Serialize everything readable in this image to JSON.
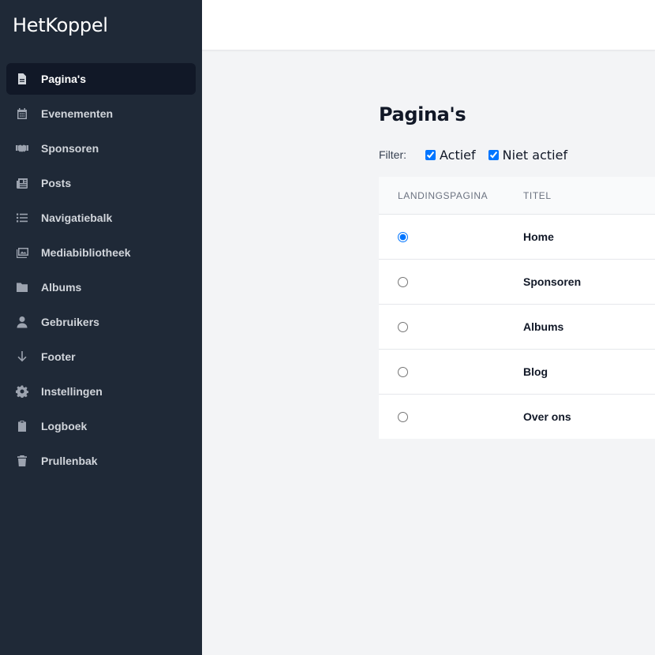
{
  "app": {
    "brand": "HetKoppel"
  },
  "sidebar": {
    "items": [
      {
        "label": "Pagina's",
        "icon": "file-icon",
        "active": true
      },
      {
        "label": "Evenementen",
        "icon": "calendar-icon",
        "active": false
      },
      {
        "label": "Sponsoren",
        "icon": "handshake-icon",
        "active": false
      },
      {
        "label": "Posts",
        "icon": "newspaper-icon",
        "active": false
      },
      {
        "label": "Navigatiebalk",
        "icon": "list-icon",
        "active": false
      },
      {
        "label": "Mediabibliotheek",
        "icon": "images-icon",
        "active": false
      },
      {
        "label": "Albums",
        "icon": "folder-icon",
        "active": false
      },
      {
        "label": "Gebruikers",
        "icon": "user-icon",
        "active": false
      },
      {
        "label": "Footer",
        "icon": "arrow-down-icon",
        "active": false
      },
      {
        "label": "Instellingen",
        "icon": "gear-icon",
        "active": false
      },
      {
        "label": "Logboek",
        "icon": "clipboard-icon",
        "active": false
      },
      {
        "label": "Prullenbak",
        "icon": "trash-icon",
        "active": false
      }
    ]
  },
  "main": {
    "title": "Pagina's",
    "filter": {
      "label": "Filter:",
      "options": [
        {
          "label": "Actief",
          "checked": true
        },
        {
          "label": "Niet actief",
          "checked": true
        }
      ]
    },
    "table": {
      "columns": [
        "Landingspagina",
        "Titel"
      ],
      "rows": [
        {
          "title": "Home",
          "landing": true
        },
        {
          "title": "Sponsoren",
          "landing": false
        },
        {
          "title": "Albums",
          "landing": false
        },
        {
          "title": "Blog",
          "landing": false
        },
        {
          "title": "Over ons",
          "landing": false
        }
      ]
    }
  },
  "colors": {
    "sidebar_bg": "#1f2937",
    "active_bg": "#111827",
    "page_bg": "#f3f4f6",
    "accent": "#0075ff"
  }
}
